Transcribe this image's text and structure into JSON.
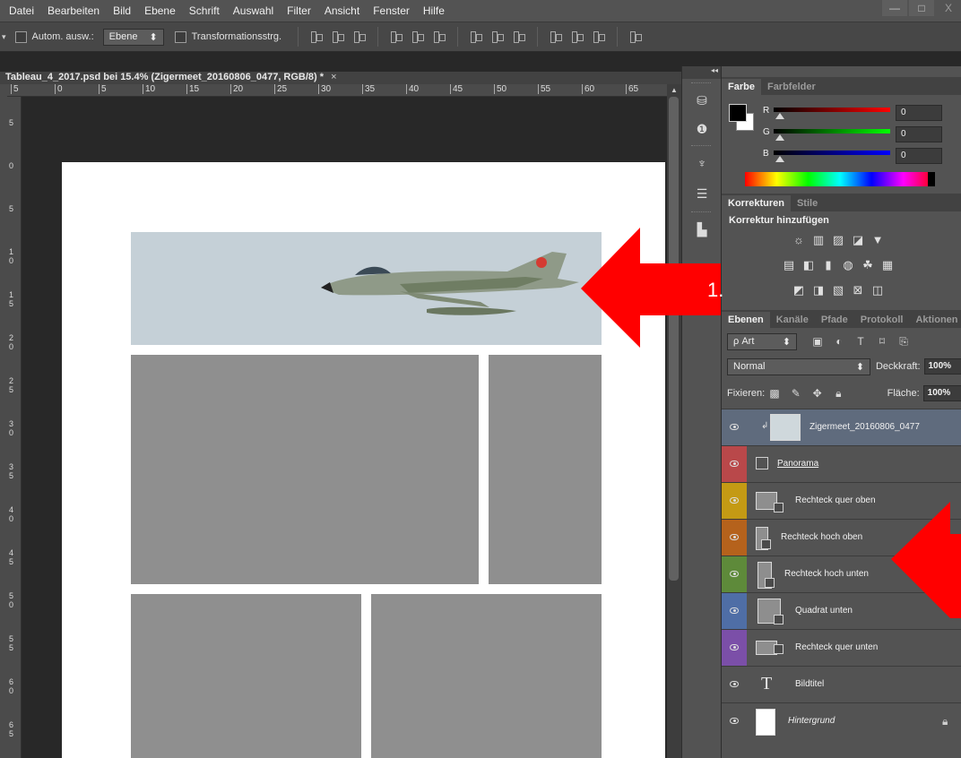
{
  "menu": [
    "Datei",
    "Bearbeiten",
    "Bild",
    "Ebene",
    "Schrift",
    "Auswahl",
    "Filter",
    "Ansicht",
    "Fenster",
    "Hilfe"
  ],
  "window": {
    "minimize": "—",
    "maximize": "□",
    "close": "X"
  },
  "options": {
    "auto_select_label": "Autom. ausw.:",
    "auto_select_value": "Ebene",
    "transform_label": "Transformationsstrg."
  },
  "document": {
    "tab_title": "Tableau_4_2017.psd bei 15.4% (Zigermeet_20160806_0477, RGB/8) *",
    "close": "×"
  },
  "ruler_top": [
    "5",
    "0",
    "5",
    "10",
    "15",
    "20",
    "25",
    "30",
    "35",
    "40",
    "45",
    "50",
    "55",
    "60",
    "65"
  ],
  "ruler_left": [
    "5",
    "0",
    "5",
    "1 0",
    "1 5",
    "2 0",
    "2 5",
    "3 0",
    "3 5",
    "4 0",
    "4 5",
    "5 0",
    "5 5",
    "6 0",
    "6 5"
  ],
  "mini_dock": {
    "collapse": "◂◂"
  },
  "color_panel": {
    "tabs": [
      "Farbe",
      "Farbfelder"
    ],
    "sliders": [
      {
        "label": "R",
        "value": "0",
        "gradient": "linear-gradient(to right,#000,#ff0000)"
      },
      {
        "label": "G",
        "value": "0",
        "gradient": "linear-gradient(to right,#000,#00ff00)"
      },
      {
        "label": "B",
        "value": "0",
        "gradient": "linear-gradient(to right,#000,#0000ff)"
      }
    ]
  },
  "adjustments_panel": {
    "tabs": [
      "Korrekturen",
      "Stile"
    ],
    "title": "Korrektur hinzufügen"
  },
  "layers_panel": {
    "tabs": [
      "Ebenen",
      "Kanäle",
      "Pfade",
      "Protokoll",
      "Aktionen"
    ],
    "filter": "ρ Art",
    "blend_mode": "Normal",
    "opacity_label": "Deckkraft:",
    "opacity_value": "100%",
    "lock_label": "Fixieren:",
    "fill_label": "Fläche:",
    "fill_value": "100%",
    "layers": [
      {
        "name": "Zigermeet_20160806_0477",
        "color": "",
        "selected": true,
        "type": "smart"
      },
      {
        "name": "Panorama",
        "color": "#b9484a",
        "selected": false,
        "type": "frame"
      },
      {
        "name": "Rechteck quer oben",
        "color": "#c49a14",
        "selected": false,
        "type": "shape"
      },
      {
        "name": "Rechteck hoch oben",
        "color": "#b5621c",
        "selected": false,
        "type": "shape"
      },
      {
        "name": "Rechteck hoch unten",
        "color": "#5e8a3a",
        "selected": false,
        "type": "shape"
      },
      {
        "name": "Quadrat unten",
        "color": "#4f6ea6",
        "selected": false,
        "type": "shape"
      },
      {
        "name": "Rechteck quer unten",
        "color": "#7b4fa8",
        "selected": false,
        "type": "shape"
      },
      {
        "name": "Bildtitel",
        "color": "",
        "selected": false,
        "type": "text"
      },
      {
        "name": "Hintergrund",
        "color": "",
        "selected": false,
        "type": "background"
      }
    ]
  },
  "annotation": {
    "label": "1.",
    "color": "#ff0000"
  }
}
